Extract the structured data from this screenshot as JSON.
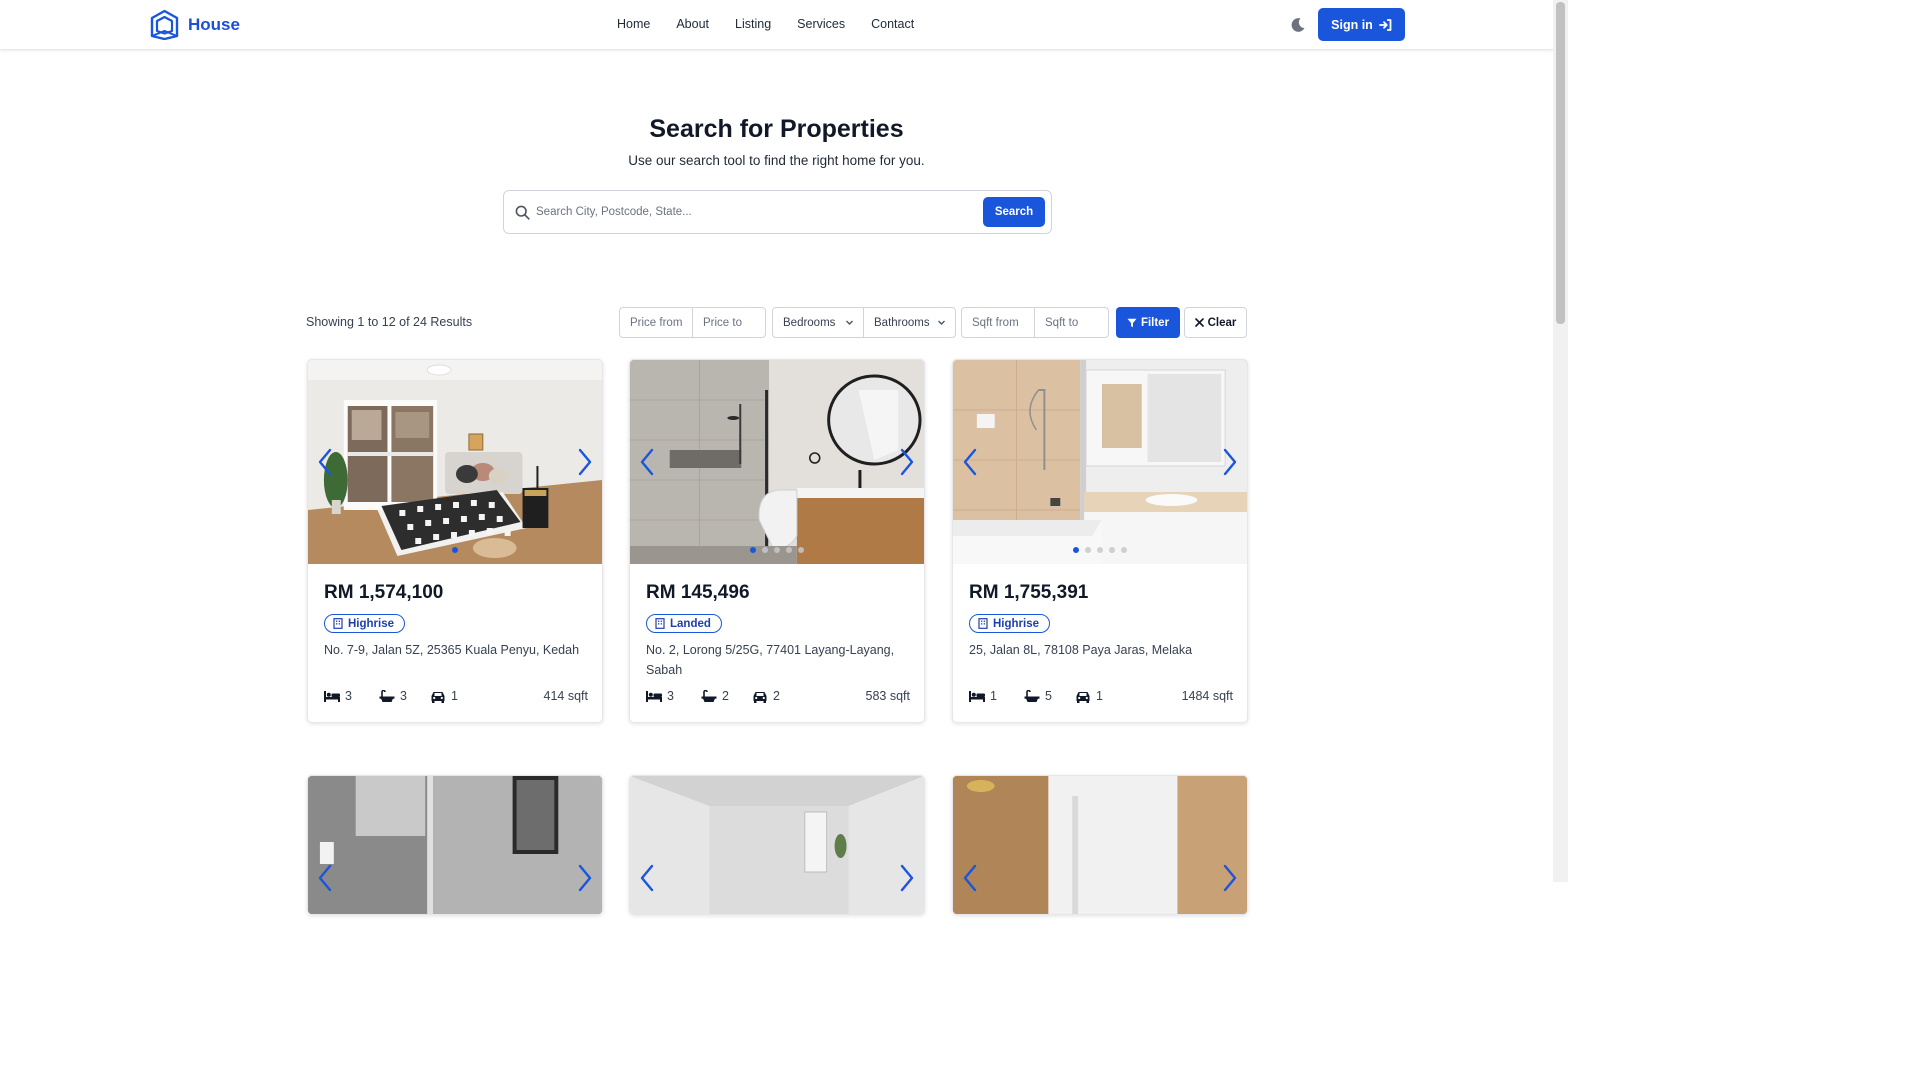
{
  "nav": {
    "brand": "House",
    "links": [
      "Home",
      "About",
      "Listing",
      "Services",
      "Contact"
    ],
    "signin": "Sign in"
  },
  "hero": {
    "title": "Search for Properties",
    "subtitle": "Use our search tool to find the right home for you.",
    "search_placeholder": "Search City, Postcode, State...",
    "search_button": "Search"
  },
  "filters": {
    "results_text": "Showing 1 to 12 of 24 Results",
    "price_from": "Price from",
    "price_to": "Price to",
    "bedrooms": "Bedrooms",
    "bathrooms": "Bathrooms",
    "sqft_from": "Sqft from",
    "sqft_to": "Sqft to",
    "filter_button": "Filter",
    "clear_button": "Clear"
  },
  "listings": [
    {
      "price": "RM 1,574,100",
      "type": "Highrise",
      "address": "No. 7-9, Jalan 5Z, 25365 Kuala Penyu, Kedah",
      "beds": "3",
      "baths": "3",
      "parking": "1",
      "sqft": "414 sqft",
      "photo_count": 1,
      "scene": "bedroom"
    },
    {
      "price": "RM 145,496",
      "type": "Landed",
      "address": "No. 2, Lorong 5/25G, 77401 Layang-Layang, Sabah",
      "beds": "3",
      "baths": "2",
      "parking": "2",
      "sqft": "583 sqft",
      "photo_count": 5,
      "scene": "bathroom-gray"
    },
    {
      "price": "RM 1,755,391",
      "type": "Highrise",
      "address": "25, Jalan 8L, 78108 Paya Jaras, Melaka",
      "beds": "1",
      "baths": "5",
      "parking": "1",
      "sqft": "1484 sqft",
      "photo_count": 5,
      "scene": "bathroom-wood"
    },
    {
      "scene": "bathroom-tile"
    },
    {
      "scene": "bathroom-light"
    },
    {
      "scene": "bathroom-marble"
    }
  ],
  "colors": {
    "primary": "#1a56db",
    "text": "#111827",
    "muted": "#374151"
  }
}
